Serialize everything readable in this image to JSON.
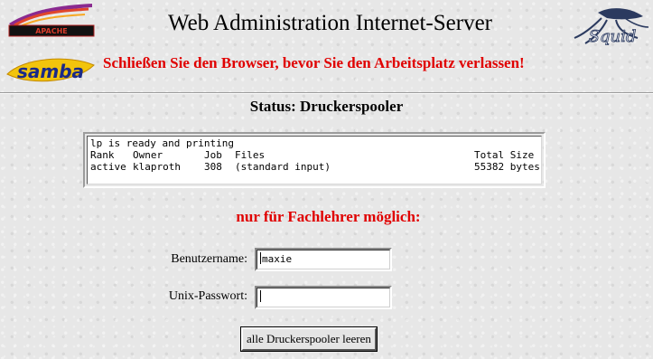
{
  "header": {
    "title": "Web Administration Internet-Server",
    "warning": "Schließen Sie den Browser, bevor Sie den Arbeitsplatz verlassen!",
    "logos": {
      "left_top": "APACHE",
      "left_bottom": "samba",
      "right": "Squid"
    }
  },
  "status": {
    "title": "Status: Druckerspooler"
  },
  "queue": {
    "status_line": "lp is ready and printing",
    "headers": {
      "rank": "Rank",
      "owner": "Owner",
      "job": "Job",
      "files": "Files",
      "total_size": "Total Size"
    },
    "rows": [
      {
        "rank": "active",
        "owner": "klaproth",
        "job": "308",
        "files": "(standard input)",
        "total_size": "55382 bytes"
      }
    ]
  },
  "restriction": {
    "text": "nur für Fachlehrer möglich:"
  },
  "form": {
    "username_label": "Benutzername:",
    "username_value": "maxie",
    "password_label": "Unix-Passwort:",
    "password_value": "",
    "submit_label": "alle Druckerspooler leeren"
  },
  "colors": {
    "warning": "#e00000",
    "background": "#e7e7e7"
  }
}
